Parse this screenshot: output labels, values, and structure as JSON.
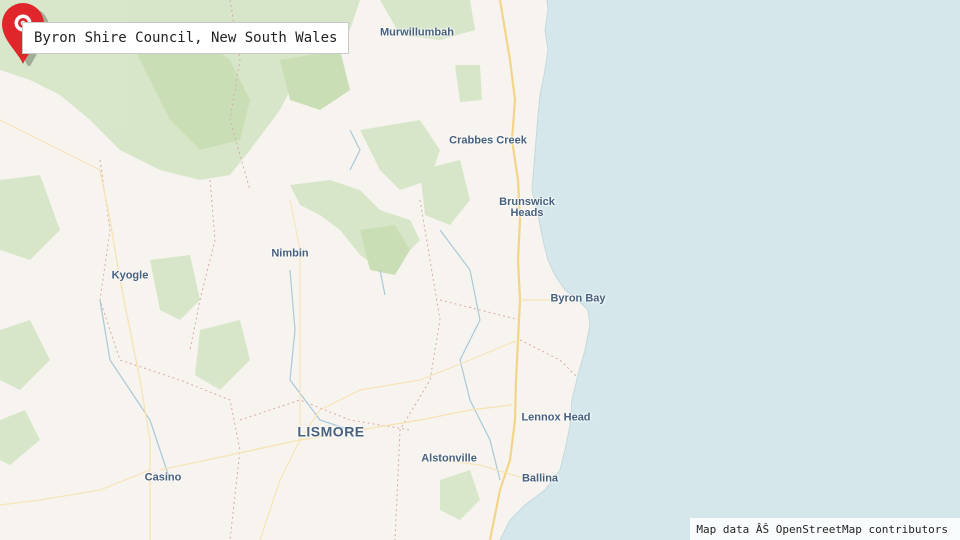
{
  "title": "Byron Shire Council, New South Wales",
  "attribution": "Map data ÂŠ OpenStreetMap contributors",
  "colors": {
    "land": "#f7f4ef",
    "water": "#d5e7eb",
    "forest": "#d3e5c4",
    "marker": "#e0262a"
  },
  "places": {
    "murwillumbah": "Murwillumbah",
    "crabbes_creek": "Crabbes Creek",
    "brunswick_heads": "Brunswick\nHeads",
    "byron_bay": "Byron Bay",
    "nimbin": "Nimbin",
    "kyogle": "Kyogle",
    "lismore": "LISMORE",
    "lennox_head": "Lennox Head",
    "alstonville": "Alstonville",
    "ballina": "Ballina",
    "casino": "Casino"
  },
  "marker_icon": "map-pin-icon"
}
